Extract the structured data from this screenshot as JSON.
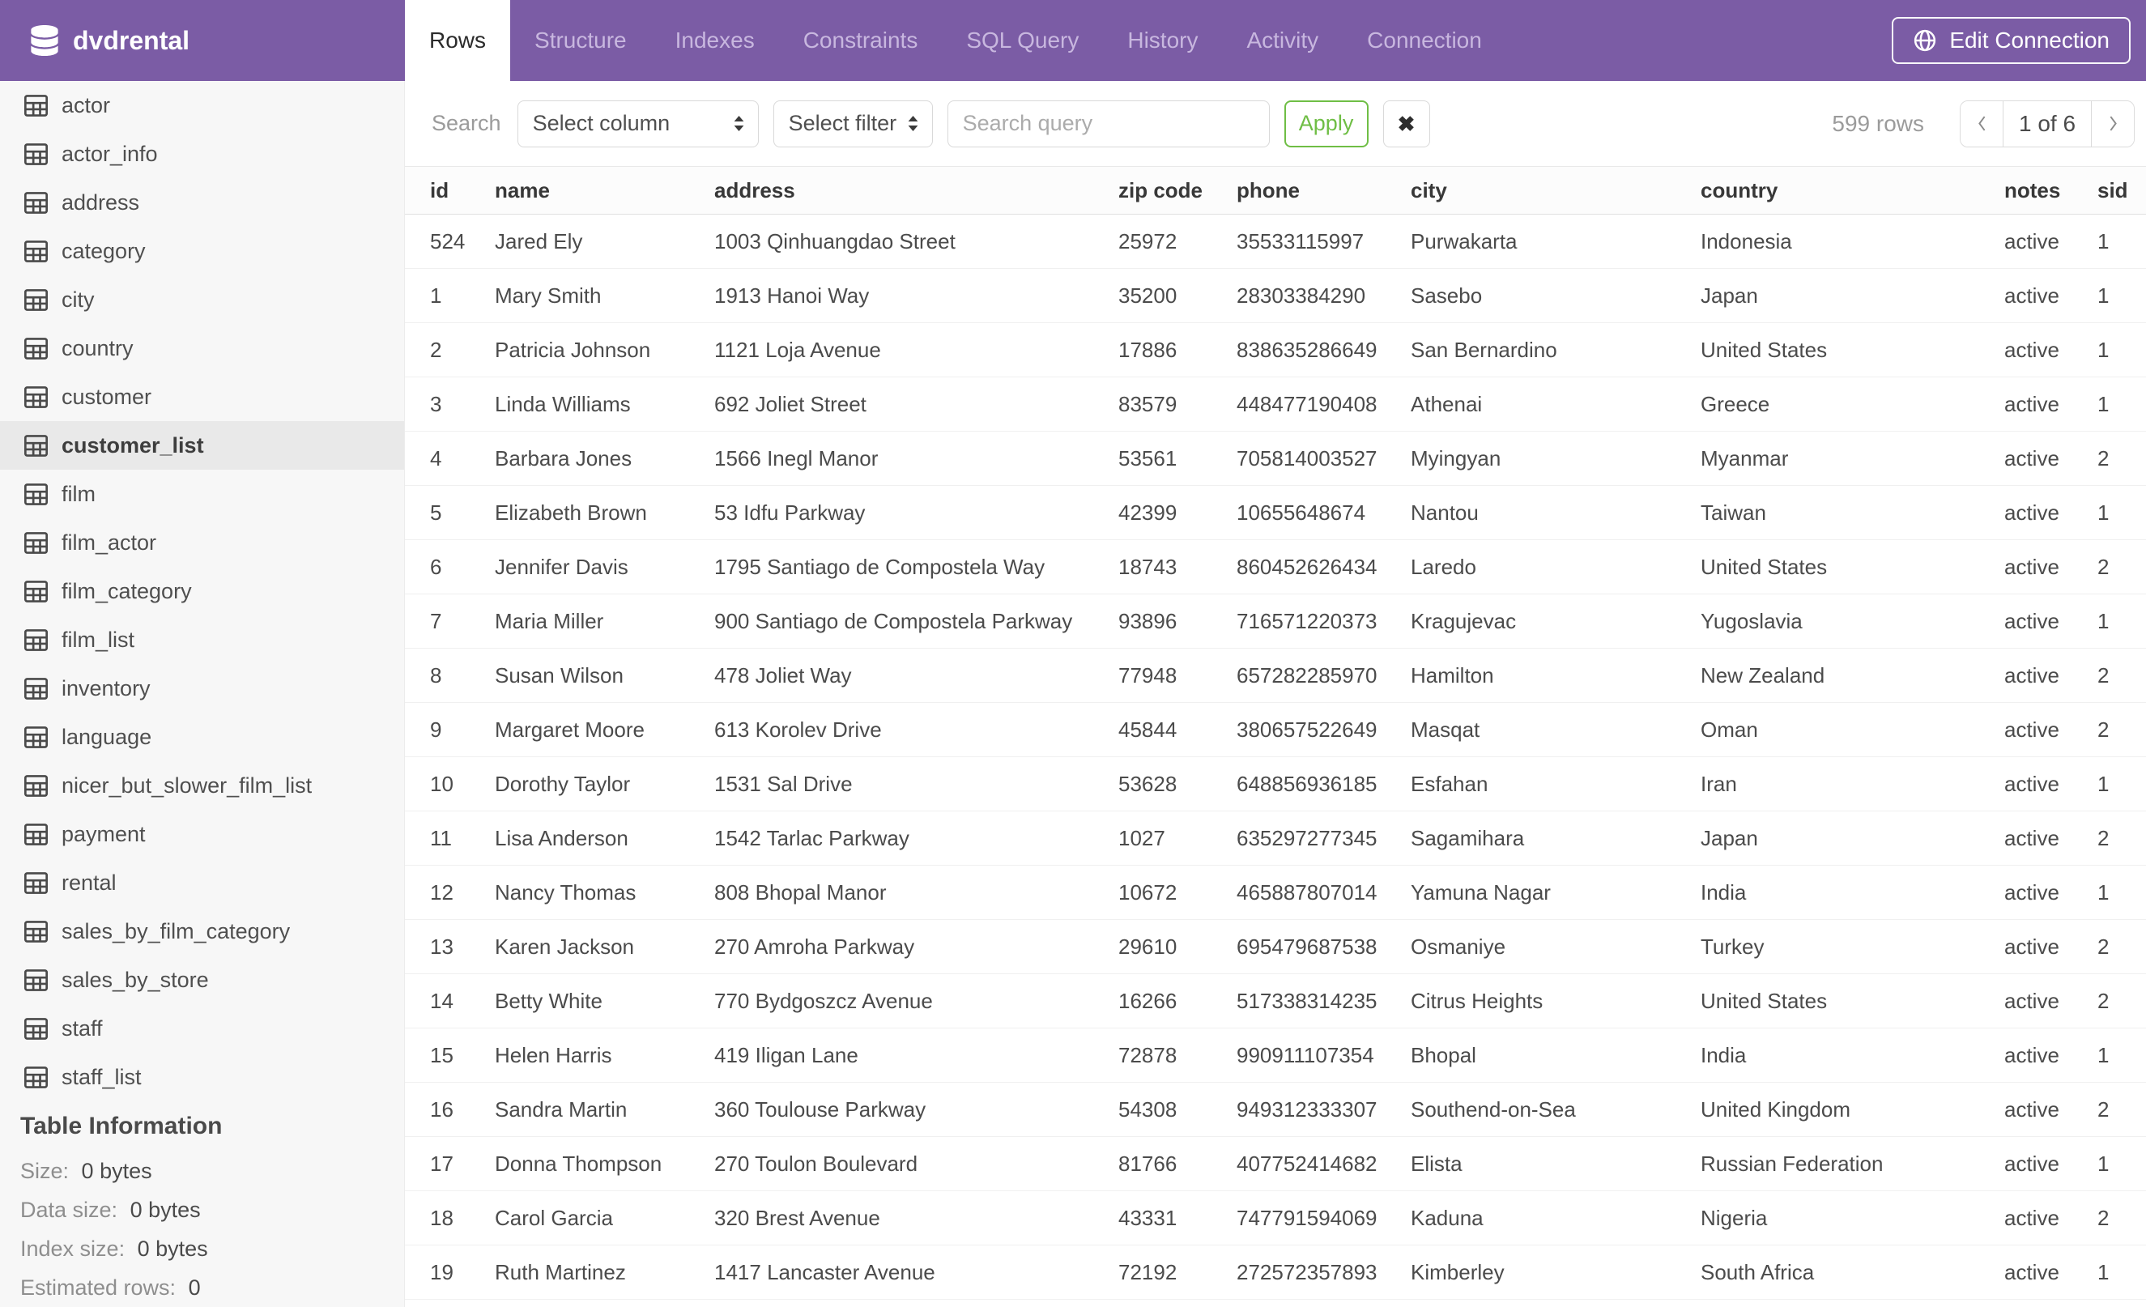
{
  "header": {
    "database_name": "dvdrental",
    "tabs": [
      "Rows",
      "Structure",
      "Indexes",
      "Constraints",
      "SQL Query",
      "History",
      "Activity",
      "Connection"
    ],
    "active_tab": "Rows",
    "edit_connection_label": "Edit Connection"
  },
  "sidebar": {
    "tables": [
      "actor",
      "actor_info",
      "address",
      "category",
      "city",
      "country",
      "customer",
      "customer_list",
      "film",
      "film_actor",
      "film_category",
      "film_list",
      "inventory",
      "language",
      "nicer_but_slower_film_list",
      "payment",
      "rental",
      "sales_by_film_category",
      "sales_by_store",
      "staff",
      "staff_list"
    ],
    "selected_table": "customer_list",
    "table_information": {
      "heading": "Table Information",
      "rows": [
        {
          "label": "Size:",
          "value": "0 bytes"
        },
        {
          "label": "Data size:",
          "value": "0 bytes"
        },
        {
          "label": "Index size:",
          "value": "0 bytes"
        },
        {
          "label": "Estimated rows:",
          "value": "0"
        }
      ]
    }
  },
  "toolbar": {
    "search_label": "Search",
    "column_select": "Select column",
    "filter_select": "Select filter",
    "query_placeholder": "Search query",
    "query_value": "",
    "apply_label": "Apply",
    "clear_icon": "✖",
    "row_count": "599 rows",
    "pagination_current": "1 of 6"
  },
  "table": {
    "columns": [
      "id",
      "name",
      "address",
      "zip code",
      "phone",
      "city",
      "country",
      "notes",
      "sid"
    ],
    "rows": [
      {
        "id": "524",
        "name": "Jared Ely",
        "address": "1003 Qinhuangdao Street",
        "zip": "25972",
        "phone": "35533115997",
        "city": "Purwakarta",
        "country": "Indonesia",
        "notes": "active",
        "sid": "1"
      },
      {
        "id": "1",
        "name": "Mary Smith",
        "address": "1913 Hanoi Way",
        "zip": "35200",
        "phone": "28303384290",
        "city": "Sasebo",
        "country": "Japan",
        "notes": "active",
        "sid": "1"
      },
      {
        "id": "2",
        "name": "Patricia Johnson",
        "address": "1121 Loja Avenue",
        "zip": "17886",
        "phone": "838635286649",
        "city": "San Bernardino",
        "country": "United States",
        "notes": "active",
        "sid": "1"
      },
      {
        "id": "3",
        "name": "Linda Williams",
        "address": "692 Joliet Street",
        "zip": "83579",
        "phone": "448477190408",
        "city": "Athenai",
        "country": "Greece",
        "notes": "active",
        "sid": "1"
      },
      {
        "id": "4",
        "name": "Barbara Jones",
        "address": "1566 Inegl Manor",
        "zip": "53561",
        "phone": "705814003527",
        "city": "Myingyan",
        "country": "Myanmar",
        "notes": "active",
        "sid": "2"
      },
      {
        "id": "5",
        "name": "Elizabeth Brown",
        "address": "53 Idfu Parkway",
        "zip": "42399",
        "phone": "10655648674",
        "city": "Nantou",
        "country": "Taiwan",
        "notes": "active",
        "sid": "1"
      },
      {
        "id": "6",
        "name": "Jennifer Davis",
        "address": "1795 Santiago de Compostela Way",
        "zip": "18743",
        "phone": "860452626434",
        "city": "Laredo",
        "country": "United States",
        "notes": "active",
        "sid": "2"
      },
      {
        "id": "7",
        "name": "Maria Miller",
        "address": "900 Santiago de Compostela Parkway",
        "zip": "93896",
        "phone": "716571220373",
        "city": "Kragujevac",
        "country": "Yugoslavia",
        "notes": "active",
        "sid": "1"
      },
      {
        "id": "8",
        "name": "Susan Wilson",
        "address": "478 Joliet Way",
        "zip": "77948",
        "phone": "657282285970",
        "city": "Hamilton",
        "country": "New Zealand",
        "notes": "active",
        "sid": "2"
      },
      {
        "id": "9",
        "name": "Margaret Moore",
        "address": "613 Korolev Drive",
        "zip": "45844",
        "phone": "380657522649",
        "city": "Masqat",
        "country": "Oman",
        "notes": "active",
        "sid": "2"
      },
      {
        "id": "10",
        "name": "Dorothy Taylor",
        "address": "1531 Sal Drive",
        "zip": "53628",
        "phone": "648856936185",
        "city": "Esfahan",
        "country": "Iran",
        "notes": "active",
        "sid": "1"
      },
      {
        "id": "11",
        "name": "Lisa Anderson",
        "address": "1542 Tarlac Parkway",
        "zip": "1027",
        "phone": "635297277345",
        "city": "Sagamihara",
        "country": "Japan",
        "notes": "active",
        "sid": "2"
      },
      {
        "id": "12",
        "name": "Nancy Thomas",
        "address": "808 Bhopal Manor",
        "zip": "10672",
        "phone": "465887807014",
        "city": "Yamuna Nagar",
        "country": "India",
        "notes": "active",
        "sid": "1"
      },
      {
        "id": "13",
        "name": "Karen Jackson",
        "address": "270 Amroha Parkway",
        "zip": "29610",
        "phone": "695479687538",
        "city": "Osmaniye",
        "country": "Turkey",
        "notes": "active",
        "sid": "2"
      },
      {
        "id": "14",
        "name": "Betty White",
        "address": "770 Bydgoszcz Avenue",
        "zip": "16266",
        "phone": "517338314235",
        "city": "Citrus Heights",
        "country": "United States",
        "notes": "active",
        "sid": "2"
      },
      {
        "id": "15",
        "name": "Helen Harris",
        "address": "419 Iligan Lane",
        "zip": "72878",
        "phone": "990911107354",
        "city": "Bhopal",
        "country": "India",
        "notes": "active",
        "sid": "1"
      },
      {
        "id": "16",
        "name": "Sandra Martin",
        "address": "360 Toulouse Parkway",
        "zip": "54308",
        "phone": "949312333307",
        "city": "Southend-on-Sea",
        "country": "United Kingdom",
        "notes": "active",
        "sid": "2"
      },
      {
        "id": "17",
        "name": "Donna Thompson",
        "address": "270 Toulon Boulevard",
        "zip": "81766",
        "phone": "407752414682",
        "city": "Elista",
        "country": "Russian Federation",
        "notes": "active",
        "sid": "1"
      },
      {
        "id": "18",
        "name": "Carol Garcia",
        "address": "320 Brest Avenue",
        "zip": "43331",
        "phone": "747791594069",
        "city": "Kaduna",
        "country": "Nigeria",
        "notes": "active",
        "sid": "2"
      },
      {
        "id": "19",
        "name": "Ruth Martinez",
        "address": "1417 Lancaster Avenue",
        "zip": "72192",
        "phone": "272572357893",
        "city": "Kimberley",
        "country": "South Africa",
        "notes": "active",
        "sid": "1"
      }
    ]
  },
  "colors": {
    "header-purple": "#7B5CA5",
    "tab-inactive": "#C8B7DF",
    "apply-green": "#6FBE45"
  }
}
